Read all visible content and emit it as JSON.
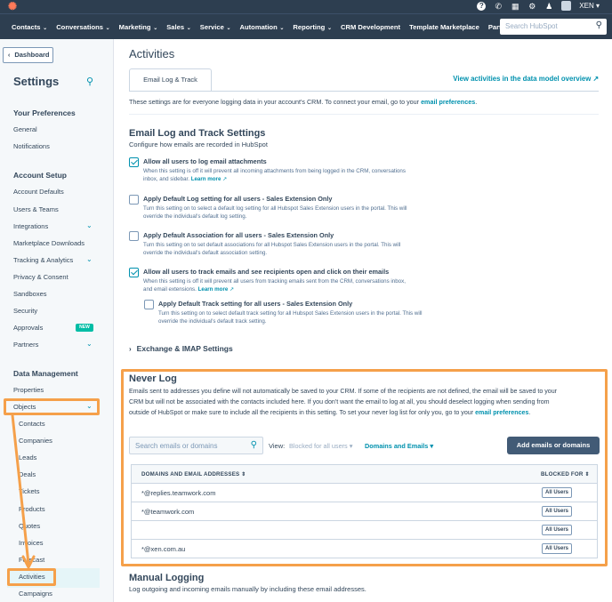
{
  "topbar": {
    "account": "XEN"
  },
  "nav": {
    "items": [
      "Contacts",
      "Conversations",
      "Marketing",
      "Sales",
      "Service",
      "Automation",
      "Reporting",
      "CRM Development",
      "Template Marketplace",
      "Partner"
    ],
    "dropdown_flags": [
      true,
      true,
      true,
      true,
      true,
      true,
      true,
      false,
      false,
      true
    ],
    "search_placeholder": "Search HubSpot"
  },
  "sidebar": {
    "back_label": "Dashboard",
    "title": "Settings",
    "sections": {
      "preferences": {
        "title": "Your Preferences",
        "items": [
          "General",
          "Notifications"
        ]
      },
      "account_setup": {
        "title": "Account Setup",
        "items": [
          "Account Defaults",
          "Users & Teams",
          "Integrations",
          "Marketplace Downloads",
          "Tracking & Analytics",
          "Privacy & Consent",
          "Sandboxes",
          "Security",
          "Approvals",
          "Partners"
        ],
        "approvals_badge": "NEW"
      },
      "data_management": {
        "title": "Data Management",
        "items": [
          "Properties",
          "Objects"
        ],
        "object_items": [
          "Contacts",
          "Companies",
          "Leads",
          "Deals",
          "Tickets",
          "Products",
          "Quotes",
          "Invoices",
          "Forecast",
          "Activities",
          "Campaigns"
        ]
      }
    }
  },
  "main": {
    "title": "Activities",
    "tab": "Email Log & Track",
    "data_model_link": "View activities in the data model overview",
    "intro_text": "These settings are for everyone logging data in your account's CRM. To connect your email, go to your",
    "intro_link": "email preferences",
    "email_settings": {
      "title": "Email Log and Track Settings",
      "subtitle": "Configure how emails are recorded in HubSpot",
      "options": [
        {
          "label": "Allow all users to log email attachments",
          "desc": "When this setting is off it will prevent all incoming attachments from being logged in the CRM, conversations inbox, and sidebar.",
          "link": "Learn more",
          "checked": true
        },
        {
          "label": "Apply Default Log setting for all users - Sales Extension Only",
          "desc": "Turn this setting on to select a default log setting for all Hubspot Sales Extension users in the portal. This will override the individual's default log setting.",
          "link": "",
          "checked": false
        },
        {
          "label": "Apply Default Association for all users - Sales Extension Only",
          "desc": "Turn this setting on to set default associations for all Hubspot Sales Extension users in the portal. This will override the individual's default association setting.",
          "link": "",
          "checked": false
        },
        {
          "label": "Allow all users to track emails and see recipients open and click on their emails",
          "desc": "When this setting is off it will prevent all users from tracking emails sent from the CRM, conversations inbox, and email extensions.",
          "link": "Learn more",
          "checked": true
        }
      ],
      "sub_option": {
        "label": "Apply Default Track setting for all users - Sales Extension Only",
        "desc": "Turn this setting on to select default track setting for all Hubspot Sales Extension users in the portal. This will override the individual's default track setting.",
        "checked": false
      }
    },
    "exchange": "Exchange & IMAP Settings",
    "never_log": {
      "title": "Never Log",
      "desc": "Emails sent to addresses you define will not automatically be saved to your CRM. If some of the recipients are not defined, the email will be saved to your CRM but will not be associated with the contacts included here. If you don't want the email to log at all, you should deselect logging when sending from outside of HubSpot or make sure to include all the recipients in this setting. To set your never log list for only you, go to your",
      "desc_link": "email preferences",
      "search_placeholder": "Search emails or domains",
      "view_label": "View:",
      "view_filter": "Blocked for all users",
      "type_filter": "Domains and Emails",
      "add_button": "Add emails or domains",
      "columns": [
        "DOMAINS AND EMAIL ADDRESSES",
        "BLOCKED FOR"
      ],
      "rows": [
        {
          "address": "*@replies.teamwork.com",
          "blocked": "All Users"
        },
        {
          "address": "*@teamwork.com",
          "blocked": "All Users"
        },
        {
          "address": "",
          "blocked": "All Users"
        },
        {
          "address": "*@xen.com.au",
          "blocked": "All Users"
        }
      ]
    },
    "manual_logging": {
      "title": "Manual Logging",
      "desc": "Log outgoing and incoming emails manually by including these email addresses."
    }
  },
  "colors": {
    "nav_bg": "#2d3e50",
    "link": "#0091ae",
    "annotation": "#f5a04a",
    "button_dark": "#425b76"
  }
}
